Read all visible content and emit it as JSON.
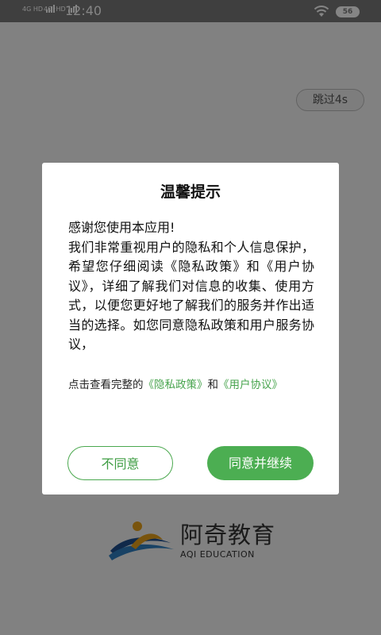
{
  "status_bar": {
    "network1": "4G HD",
    "network2": "4G⁺HD",
    "time": "12:40",
    "battery": "56"
  },
  "splash": {
    "skip_label": "跳过4s",
    "brand_name": "阿奇教育",
    "brand_name_en": "AQI EDUCATION"
  },
  "dialog": {
    "title": "温馨提示",
    "body": "感谢您使用本应用!\n我们非常重视用户的隐私和个人信息保护，希望您仔细阅读《隐私政策》和《用户协议》，详细了解我们对信息的收集、使用方式，以便您更好地了解我们的服务并作出适当的选择。如您同意隐私政策和用户服务协议，",
    "links_prefix": "点击查看完整的",
    "privacy_link": "《隐私政策》",
    "and_text": "和",
    "agreement_link": "《用户协议》",
    "disagree_label": "不同意",
    "agree_label": "同意并继续"
  },
  "colors": {
    "accent_green": "#4cae52",
    "overlay": "rgba(0,0,0,0.48)"
  }
}
